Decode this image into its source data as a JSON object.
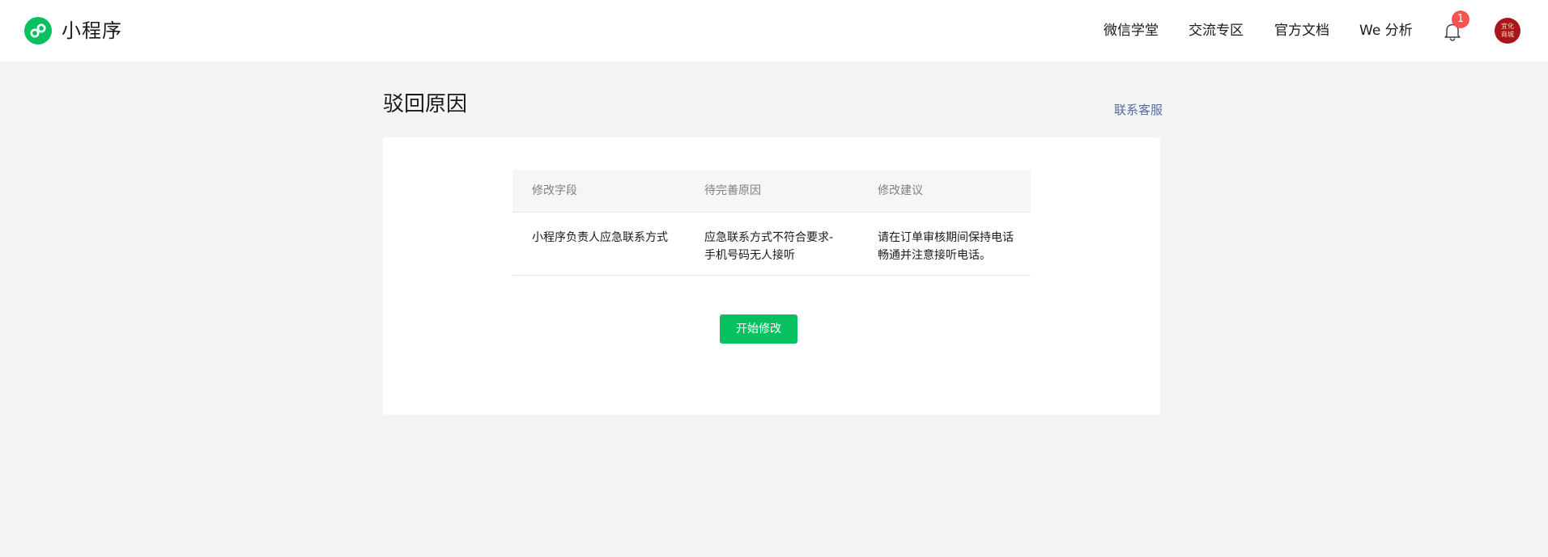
{
  "header": {
    "brand": "小程序",
    "nav": [
      "微信学堂",
      "交流专区",
      "官方文档",
      "We 分析"
    ],
    "notification_count": "1",
    "avatar_text": [
      "宜化",
      "商城"
    ]
  },
  "page": {
    "title": "驳回原因",
    "contact_link": "联系客服"
  },
  "table": {
    "columns": [
      "修改字段",
      "待完善原因",
      "修改建议"
    ],
    "rows": [
      [
        "小程序负责人应急联系方式",
        "应急联系方式不符合要求-手机号码无人接听",
        "请在订单审核期间保持电话畅通并注意接听电话。"
      ]
    ]
  },
  "actions": {
    "start_edit": "开始修改"
  },
  "colors": {
    "accent": "#07c160",
    "link": "#576b95",
    "badge": "#fa5151",
    "background": "#f3f4f6"
  },
  "icons": [
    "miniprogram-logo-icon",
    "bell-icon"
  ]
}
